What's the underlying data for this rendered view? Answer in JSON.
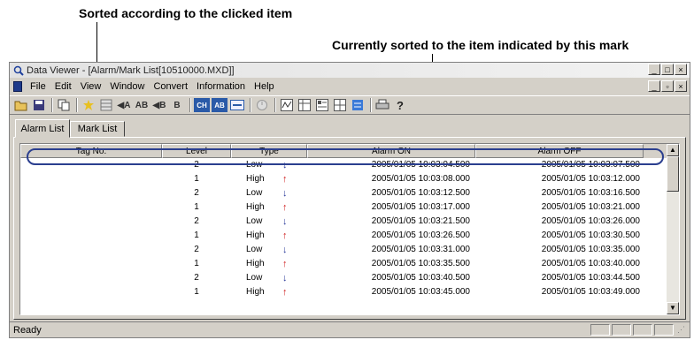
{
  "annotations": {
    "sorted_by_clicked": "Sorted according to the clicked item",
    "current_sort_mark": "Currently sorted to the item indicated by this mark"
  },
  "window": {
    "title": "Data Viewer - [Alarm/Mark List[10510000.MXD]]",
    "app_icon": "magnifier-icon"
  },
  "menu": {
    "items": [
      "File",
      "Edit",
      "View",
      "Window",
      "Convert",
      "Information",
      "Help"
    ]
  },
  "toolbar": {
    "labels": {
      "ch": "CH",
      "ab": "AB",
      "kab": "AB",
      "kb": "B"
    }
  },
  "tabs": [
    {
      "label": "Alarm List",
      "active": true
    },
    {
      "label": "Mark List",
      "active": false
    }
  ],
  "table": {
    "columns": [
      "Tag No.",
      "Level",
      "Type",
      "Alarm ON",
      "Alarm OFF"
    ],
    "sort_indicator": "▲",
    "rows": [
      {
        "tag": "",
        "level": "2",
        "type": "Low",
        "dir": "down",
        "on": "2005/01/05 10:03:04.500",
        "off": "2005/01/05 10:03:07.500"
      },
      {
        "tag": "",
        "level": "1",
        "type": "High",
        "dir": "up",
        "on": "2005/01/05 10:03:08.000",
        "off": "2005/01/05 10:03:12.000"
      },
      {
        "tag": "",
        "level": "2",
        "type": "Low",
        "dir": "down",
        "on": "2005/01/05 10:03:12.500",
        "off": "2005/01/05 10:03:16.500"
      },
      {
        "tag": "",
        "level": "1",
        "type": "High",
        "dir": "up",
        "on": "2005/01/05 10:03:17.000",
        "off": "2005/01/05 10:03:21.000"
      },
      {
        "tag": "",
        "level": "2",
        "type": "Low",
        "dir": "down",
        "on": "2005/01/05 10:03:21.500",
        "off": "2005/01/05 10:03:26.000"
      },
      {
        "tag": "",
        "level": "1",
        "type": "High",
        "dir": "up",
        "on": "2005/01/05 10:03:26.500",
        "off": "2005/01/05 10:03:30.500"
      },
      {
        "tag": "",
        "level": "2",
        "type": "Low",
        "dir": "down",
        "on": "2005/01/05 10:03:31.000",
        "off": "2005/01/05 10:03:35.000"
      },
      {
        "tag": "",
        "level": "1",
        "type": "High",
        "dir": "up",
        "on": "2005/01/05 10:03:35.500",
        "off": "2005/01/05 10:03:40.000"
      },
      {
        "tag": "",
        "level": "2",
        "type": "Low",
        "dir": "down",
        "on": "2005/01/05 10:03:40.500",
        "off": "2005/01/05 10:03:44.500"
      },
      {
        "tag": "",
        "level": "1",
        "type": "High",
        "dir": "up",
        "on": "2005/01/05 10:03:45.000",
        "off": "2005/01/05 10:03:49.000"
      }
    ]
  },
  "status": {
    "text": "Ready"
  },
  "colors": {
    "accent": "#2b3f8f",
    "up_arrow": "#d02020",
    "down_arrow": "#2a3a9a"
  }
}
